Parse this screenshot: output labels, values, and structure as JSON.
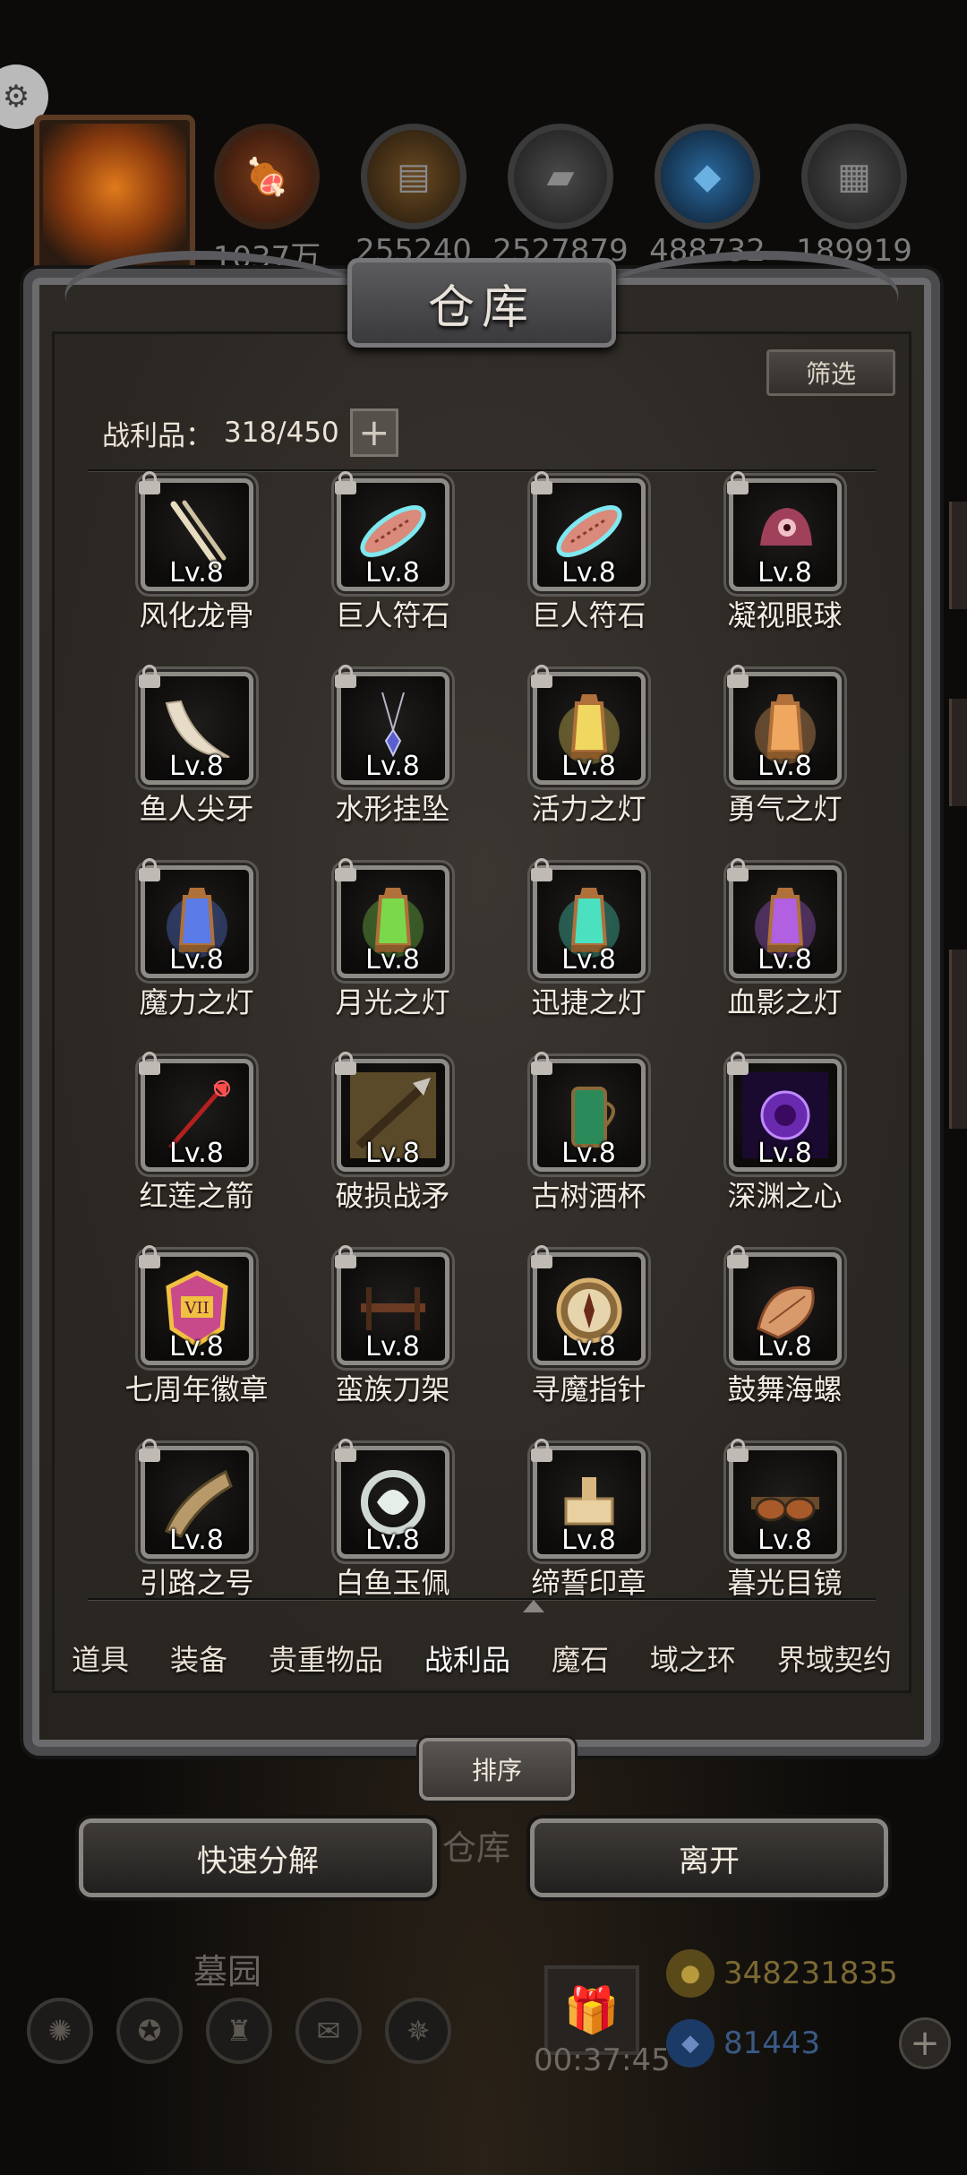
{
  "top_bar": {
    "resources": [
      {
        "icon": "meat-icon",
        "value": "1037万"
      },
      {
        "icon": "wood-icon",
        "value": "255240"
      },
      {
        "icon": "iron-icon",
        "value": "2527879"
      },
      {
        "icon": "crystal-icon",
        "value": "488732"
      },
      {
        "icon": "stone-icon",
        "value": "189919"
      }
    ]
  },
  "panel": {
    "title": "仓库",
    "filter_label": "筛选",
    "capacity_label": "战利品：",
    "capacity_value": "318/450",
    "add_capacity_symbol": "+"
  },
  "items": [
    {
      "name": "风化龙骨",
      "level": "Lv.8",
      "icon": "dragon-bone-icon"
    },
    {
      "name": "巨人符石",
      "level": "Lv.8",
      "icon": "rune-stone-icon"
    },
    {
      "name": "巨人符石",
      "level": "Lv.8",
      "icon": "rune-stone-icon"
    },
    {
      "name": "凝视眼球",
      "level": "Lv.8",
      "icon": "eyeball-icon"
    },
    {
      "name": "鱼人尖牙",
      "level": "Lv.8",
      "icon": "fang-icon"
    },
    {
      "name": "水形挂坠",
      "level": "Lv.8",
      "icon": "pendant-icon"
    },
    {
      "name": "活力之灯",
      "level": "Lv.8",
      "icon": "lantern-yellow-icon"
    },
    {
      "name": "勇气之灯",
      "level": "Lv.8",
      "icon": "lantern-orange-icon"
    },
    {
      "name": "魔力之灯",
      "level": "Lv.8",
      "icon": "lantern-blue-icon"
    },
    {
      "name": "月光之灯",
      "level": "Lv.8",
      "icon": "lantern-green-icon"
    },
    {
      "name": "迅捷之灯",
      "level": "Lv.8",
      "icon": "lantern-cyan-icon"
    },
    {
      "name": "血影之灯",
      "level": "Lv.8",
      "icon": "lantern-purple-icon"
    },
    {
      "name": "红莲之箭",
      "level": "Lv.8",
      "icon": "arrow-icon"
    },
    {
      "name": "破损战矛",
      "level": "Lv.8",
      "icon": "spear-icon"
    },
    {
      "name": "古树酒杯",
      "level": "Lv.8",
      "icon": "goblet-icon"
    },
    {
      "name": "深渊之心",
      "level": "Lv.8",
      "icon": "abyss-heart-icon"
    },
    {
      "name": "七周年徽章",
      "level": "Lv.8",
      "icon": "badge-icon"
    },
    {
      "name": "蛮族刀架",
      "level": "Lv.8",
      "icon": "blade-rack-icon"
    },
    {
      "name": "寻魔指针",
      "level": "Lv.8",
      "icon": "compass-icon"
    },
    {
      "name": "鼓舞海螺",
      "level": "Lv.8",
      "icon": "conch-icon"
    },
    {
      "name": "引路之号",
      "level": "Lv.8",
      "icon": "horn-icon"
    },
    {
      "name": "白鱼玉佩",
      "level": "Lv.8",
      "icon": "jade-fish-icon"
    },
    {
      "name": "缔誓印章",
      "level": "Lv.8",
      "icon": "seal-icon"
    },
    {
      "name": "暮光目镜",
      "level": "Lv.8",
      "icon": "goggles-icon"
    }
  ],
  "tabs": [
    {
      "label": "道具",
      "active": false
    },
    {
      "label": "装备",
      "active": false
    },
    {
      "label": "贵重物品",
      "active": false
    },
    {
      "label": "战利品",
      "active": true
    },
    {
      "label": "魔石",
      "active": false
    },
    {
      "label": "域之环",
      "active": false
    },
    {
      "label": "界域契约",
      "active": false
    }
  ],
  "sort_label": "排序",
  "actions": {
    "decompose_label": "快速分解",
    "leave_label": "离开"
  },
  "background": {
    "warehouse_label": "仓库",
    "graveyard_label": "墓园",
    "timer": "00:37:45",
    "gold": "348231835",
    "gems": "81443"
  },
  "colors": {
    "panel_bg": "#2d2925",
    "frame": "#4b4a4c",
    "text": "#e6ddd0"
  }
}
